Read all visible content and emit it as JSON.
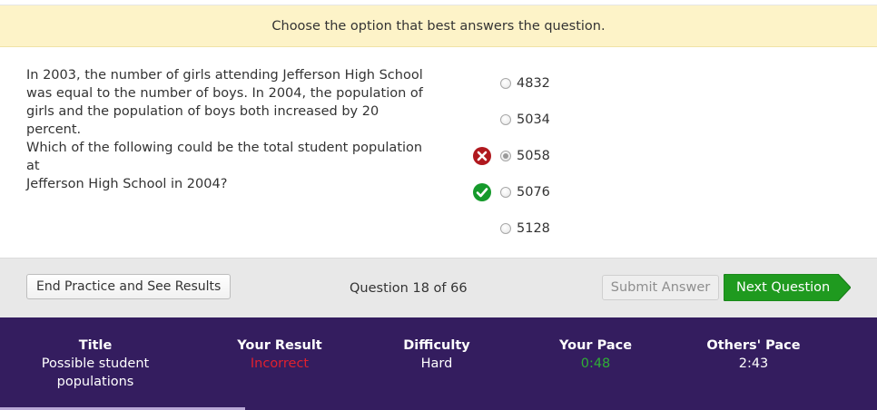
{
  "instruction": "Choose the option that best answers the question.",
  "question": {
    "line1": "In 2003, the number of girls attending Jefferson High School",
    "line2": "was equal to the number of boys. In 2004, the population of",
    "line3": "girls and the population of boys both increased by 20 percent.",
    "line4": "Which of the following could be the total student population at",
    "line5": "Jefferson High School in 2004?"
  },
  "choices": [
    {
      "label": "4832",
      "selected": false,
      "mark": ""
    },
    {
      "label": "5034",
      "selected": false,
      "mark": ""
    },
    {
      "label": "5058",
      "selected": true,
      "mark": "x-circle-icon"
    },
    {
      "label": "5076",
      "selected": false,
      "mark": "check-circle-icon"
    },
    {
      "label": "5128",
      "selected": false,
      "mark": ""
    }
  ],
  "actions": {
    "end_label": "End Practice and See Results",
    "counter": "Question 18 of 66",
    "submit_label": "Submit Answer",
    "next_label": "Next Question"
  },
  "stats": {
    "title_header": "Title",
    "title_line1": "Possible student",
    "title_line2": "populations",
    "result_header": "Your Result",
    "result_value": "Incorrect",
    "difficulty_header": "Difficulty",
    "difficulty_value": "Hard",
    "pace_header": "Your Pace",
    "pace_value": "0:48",
    "others_header": "Others' Pace",
    "others_value": "2:43"
  },
  "colors": {
    "instruction_bg": "#fdf3c8",
    "next_button": "#1f9a1f",
    "stats_bg": "#341d5f",
    "incorrect": "#e0202e",
    "pace": "#2fae35",
    "wrong_mark": "#b0181e",
    "correct_mark": "#159a2b"
  }
}
